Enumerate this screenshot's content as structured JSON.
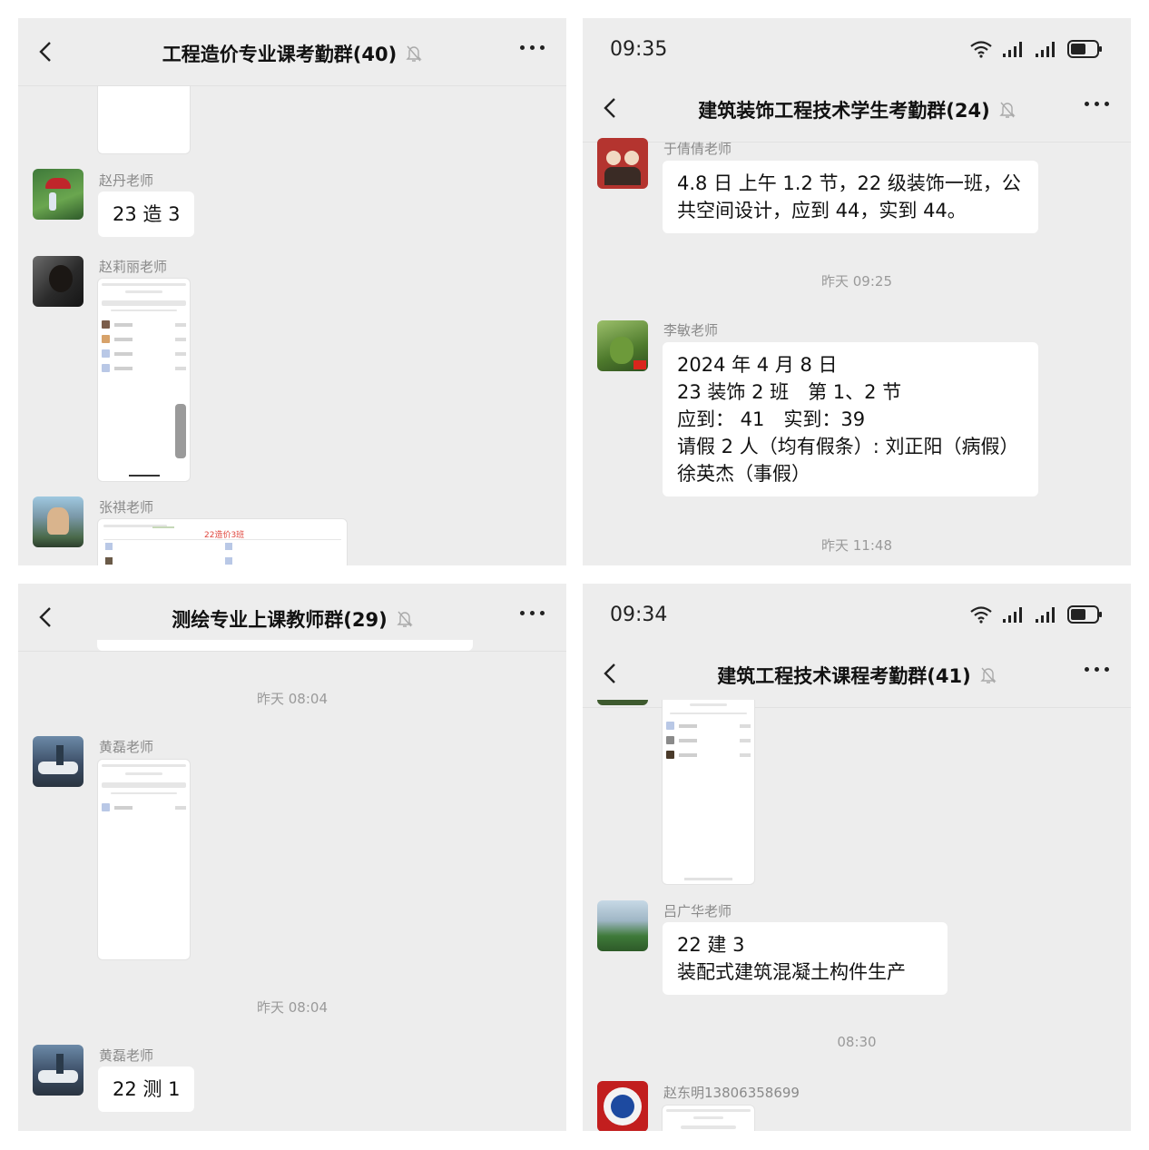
{
  "panel1": {
    "title": "工程造价专业课考勤群(40)",
    "messages": [
      {
        "sender": "赵丹老师",
        "text": "23 造 3"
      },
      {
        "sender": "赵莉丽老师"
      },
      {
        "sender": "张祺老师",
        "thumb_caption": "22造价3班"
      }
    ]
  },
  "panel2": {
    "time": "09:35",
    "title": "建筑装饰工程技术学生考勤群(24)",
    "messages": [
      {
        "sender": "于倩倩老师",
        "lines": [
          "4.8 日 上午 1.2 节，22 级装饰一班，公",
          "共空间设计，应到 44，实到 44。"
        ]
      },
      {
        "timestamp": "昨天 09:25"
      },
      {
        "sender": "李敏老师",
        "lines": [
          "2024 年 4 月 8 日",
          "23 装饰 2 班　第 1、2 节",
          "应到： 41　实到：39",
          "请假 2 人（均有假条）: 刘正阳（病假）",
          "徐英杰（事假）"
        ]
      },
      {
        "timestamp": "昨天 11:48"
      }
    ]
  },
  "panel3": {
    "title": "测绘专业上课教师群(29)",
    "messages": [
      {
        "timestamp": "昨天 08:04"
      },
      {
        "sender": "黄磊老师"
      },
      {
        "timestamp": "昨天 08:04"
      },
      {
        "sender": "黄磊老师",
        "text": "22 测 1"
      }
    ]
  },
  "panel4": {
    "time": "09:34",
    "title": "建筑工程技术课程考勤群(41)",
    "messages": [
      {
        "sender": "吕广华老师",
        "lines": [
          "22 建 3",
          "装配式建筑混凝土构件生产"
        ]
      },
      {
        "timestamp": "08:30"
      },
      {
        "sender": "赵东明13806358699"
      }
    ]
  },
  "colors": {
    "chat_bg": "#ededed",
    "bubble": "#ffffff",
    "meta_text": "#8a8a8a"
  },
  "icons": [
    "back-icon",
    "mute-bell-icon",
    "more-icon",
    "wifi-icon",
    "signal-icon",
    "battery-icon"
  ]
}
